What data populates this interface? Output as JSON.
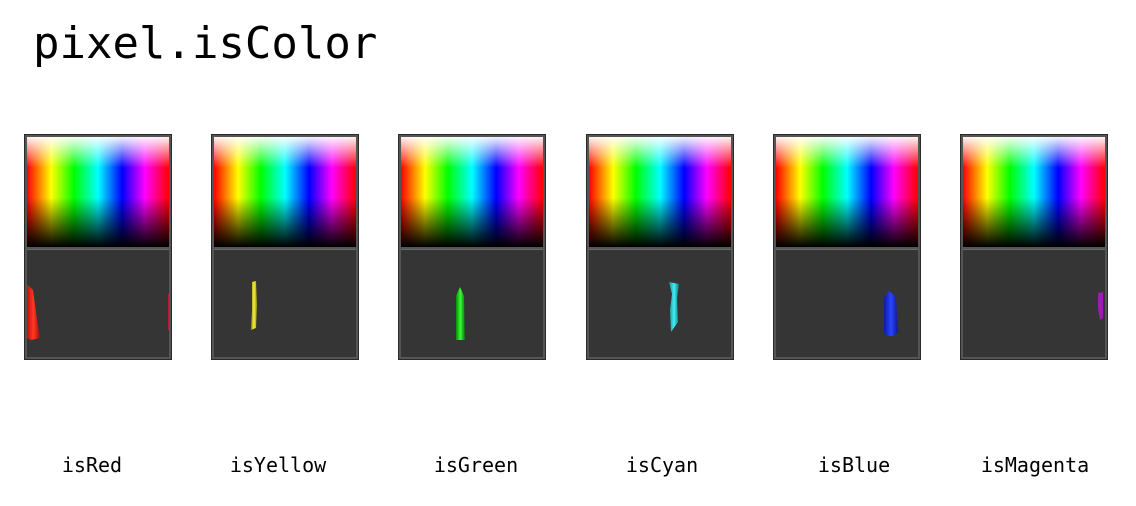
{
  "title": "pixel.isColor",
  "panels": [
    {
      "label": "isRed",
      "color": "#ff2a1a"
    },
    {
      "label": "isYellow",
      "color": "#e8e020"
    },
    {
      "label": "isGreen",
      "color": "#22dd22"
    },
    {
      "label": "isCyan",
      "color": "#22d8dd"
    },
    {
      "label": "isBlue",
      "color": "#1a33ff"
    },
    {
      "label": "isMagenta",
      "color": "#aa22cc"
    }
  ]
}
